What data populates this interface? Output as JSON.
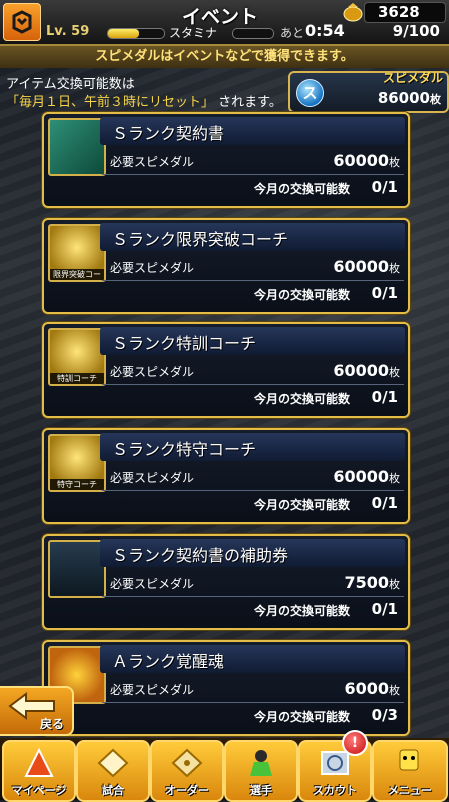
{
  "header": {
    "title": "イベント",
    "coins": "3628",
    "level": "Lv. 59",
    "stamina_label": "スタミナ",
    "ato_label": "あと",
    "timer": "0:54",
    "stamina_value": "9/100"
  },
  "notice": "スピメダルはイベントなどで獲得できます。",
  "info": {
    "line1": "アイテム交換可能数は",
    "line2_highlight": "「毎月１日、午前３時にリセット」",
    "line2_rest": "されます。"
  },
  "medal": {
    "label": "スピメダル",
    "value": "86000",
    "unit": "枚",
    "icon_letter": "ス"
  },
  "labels": {
    "required": "必要スピメダル",
    "limit": "今月の交換可能数"
  },
  "items": [
    {
      "name": "Ｓランク契約書",
      "cost": "60000",
      "unit": "枚",
      "limit": "0/1",
      "caption": ""
    },
    {
      "name": "Ｓランク限界突破コーチ",
      "cost": "60000",
      "unit": "枚",
      "limit": "0/1",
      "caption": "限界突破コーチ"
    },
    {
      "name": "Ｓランク特訓コーチ",
      "cost": "60000",
      "unit": "枚",
      "limit": "0/1",
      "caption": "特訓コーチ"
    },
    {
      "name": "Ｓランク特守コーチ",
      "cost": "60000",
      "unit": "枚",
      "limit": "0/1",
      "caption": "特守コーチ"
    },
    {
      "name": "Ｓランク契約書の補助券",
      "cost": "7500",
      "unit": "枚",
      "limit": "0/1",
      "caption": ""
    },
    {
      "name": "Ａランク覚醒魂",
      "cost": "6000",
      "unit": "枚",
      "limit": "0/3",
      "caption": ""
    }
  ],
  "back_label": "戻る",
  "tabs": [
    {
      "label": "マイページ"
    },
    {
      "label": "試合"
    },
    {
      "label": "オーダー"
    },
    {
      "label": "選手"
    },
    {
      "label": "スカウト"
    },
    {
      "label": "メニュー"
    }
  ],
  "scout_badge": "!"
}
